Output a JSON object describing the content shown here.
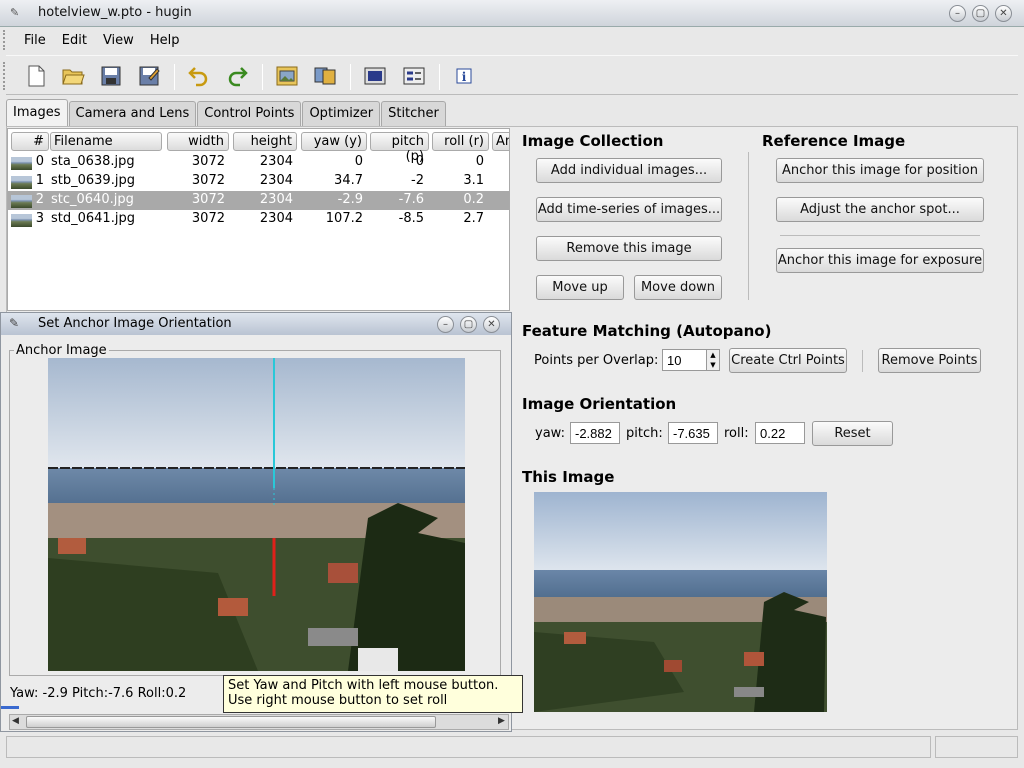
{
  "window": {
    "title": "hotelview_w.pto - hugin"
  },
  "menubar": {
    "items": [
      "File",
      "Edit",
      "View",
      "Help"
    ]
  },
  "toolbar": {
    "icons": [
      "new-icon",
      "open-icon",
      "save-icon",
      "save-as-icon",
      "undo-icon",
      "redo-icon",
      "add-images-icon",
      "assistant-icon",
      "preview-icon",
      "fast-preview-icon",
      "info-icon"
    ]
  },
  "tabs": [
    "Images",
    "Camera and Lens",
    "Control Points",
    "Optimizer",
    "Stitcher"
  ],
  "table": {
    "headers": [
      "#",
      "Filename",
      "width",
      "height",
      "yaw (y)",
      "pitch (p)",
      "roll (r)",
      "An"
    ],
    "rows": [
      {
        "num": "0",
        "file": "sta_0638.jpg",
        "width": "3072",
        "height": "2304",
        "yaw": "0",
        "pitch": "0",
        "roll": "0"
      },
      {
        "num": "1",
        "file": "stb_0639.jpg",
        "width": "3072",
        "height": "2304",
        "yaw": "34.7",
        "pitch": "-2",
        "roll": "3.1"
      },
      {
        "num": "2",
        "file": "stc_0640.jpg",
        "width": "3072",
        "height": "2304",
        "yaw": "-2.9",
        "pitch": "-7.6",
        "roll": "0.2"
      },
      {
        "num": "3",
        "file": "std_0641.jpg",
        "width": "3072",
        "height": "2304",
        "yaw": "107.2",
        "pitch": "-8.5",
        "roll": "2.7"
      }
    ],
    "selected_row": 2
  },
  "collection": {
    "title": "Image Collection",
    "add_individual": "Add individual images...",
    "add_series": "Add time-series of images...",
    "remove": "Remove this image",
    "move_up": "Move up",
    "move_down": "Move down"
  },
  "reference": {
    "title": "Reference Image",
    "anchor_position": "Anchor this image for position",
    "adjust_anchor": "Adjust the anchor spot...",
    "anchor_exposure": "Anchor this image for exposure"
  },
  "feature": {
    "title": "Feature Matching (Autopano)",
    "points_label": "Points per Overlap:",
    "points_value": "10",
    "create": "Create Ctrl Points",
    "remove": "Remove Points"
  },
  "orientation": {
    "title": "Image Orientation",
    "yaw_label": "yaw:",
    "yaw_value": "-2.882",
    "pitch_label": "pitch:",
    "pitch_value": "-7.635",
    "roll_label": "roll:",
    "roll_value": "0.22",
    "reset": "Reset"
  },
  "this_image": {
    "title": "This Image"
  },
  "dialog": {
    "title": "Set Anchor Image Orientation",
    "group": "Anchor Image",
    "status": "Yaw: -2.9 Pitch:-7.6 Roll:0.2"
  },
  "tooltip": {
    "text": "Set Yaw and Pitch with left mouse button. Use right mouse button to set roll"
  }
}
